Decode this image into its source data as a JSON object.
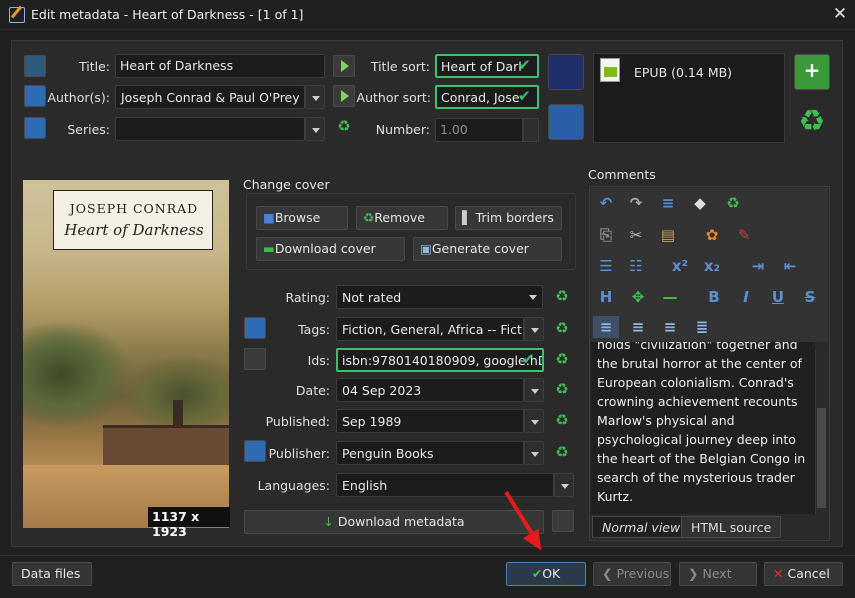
{
  "window": {
    "title": "Edit metadata - Heart of Darkness -  [1 of 1]",
    "close_glyph": "✕"
  },
  "fields": {
    "title": {
      "label": "Title:",
      "value": "Heart of Darkness"
    },
    "title_sort": {
      "label": "Title sort:",
      "value": "Heart of Darl"
    },
    "authors": {
      "label": "Author(s):",
      "value": "Joseph Conrad & Paul O'Prey"
    },
    "author_sort": {
      "label": "Author sort:",
      "value": "Conrad, Jose"
    },
    "series": {
      "label": "Series:",
      "value": ""
    },
    "number": {
      "label": "Number:",
      "value": "1.00"
    },
    "rating": {
      "label": "Rating:",
      "value": "Not rated"
    },
    "tags": {
      "label": "Tags:",
      "value": "Fiction, General, Africa -- Fiction,"
    },
    "ids": {
      "label": "Ids:",
      "value": "isbn:9780140180909, google:hD"
    },
    "date": {
      "label": "Date:",
      "value": "04 Sep 2023"
    },
    "published": {
      "label": "Published:",
      "value": "Sep 1989"
    },
    "publisher": {
      "label": "Publisher:",
      "value": "Penguin Books"
    },
    "languages": {
      "label": "Languages:",
      "value": "English"
    }
  },
  "format": {
    "label": "EPUB (0.14 MB)"
  },
  "cover": {
    "author_text": "JOSEPH CONRAD",
    "title_text": "Heart of Darkness",
    "dimensions": "1137 x 1923"
  },
  "change_cover": {
    "label": "Change cover",
    "browse": "Browse",
    "remove": "Remove",
    "trim": "Trim borders",
    "download": "Download cover",
    "generate": "Generate cover"
  },
  "download_metadata": "Download metadata",
  "comments": {
    "label": "Comments",
    "text_lines": [
      "holds \"civilization\" together and",
      "the brutal horror at the center of",
      "European colonialism. Conrad's",
      "crowning achievement recounts",
      "Marlow's physical and",
      "psychological journey deep into",
      "the heart of the Belgian Congo in",
      "search of the mysterious trader",
      "Kurtz."
    ],
    "tabs": [
      "Normal view",
      "HTML source"
    ]
  },
  "toolbar_icons": {
    "row1": [
      "undo-icon",
      "redo-icon",
      "select-all-icon",
      "clear-icon",
      "recycle-icon"
    ],
    "row2": [
      "copy-icon",
      "cut-icon",
      "paste-icon",
      "background-color-icon",
      "foreground-color-icon"
    ],
    "row3": [
      "ordered-list-icon",
      "unordered-list-icon",
      "superscript-icon",
      "subscript-icon",
      "indent-icon",
      "outdent-icon"
    ],
    "row4": [
      "heading-icon",
      "insert-link-icon",
      "horizontal-rule-icon",
      "bold-icon",
      "italic-icon",
      "underline-icon",
      "strikethrough-icon"
    ],
    "row5": [
      "align-left-icon",
      "align-center-icon",
      "align-right-icon",
      "align-justify-icon"
    ]
  },
  "toolbar_glyphs": {
    "undo": "↶",
    "redo": "↷",
    "copy": "⎘",
    "cut": "✂",
    "paste": "📋",
    "sup": "x²",
    "sub": "x₂",
    "heading": "H",
    "link": "✥",
    "bold": "B",
    "italic": "I",
    "underline": "U",
    "strike": "S"
  },
  "bottom": {
    "data_files": "Data files",
    "ok": "OK",
    "previous": "Previous",
    "next": "Next",
    "cancel": "Cancel"
  },
  "glyphs": {
    "check": "✔",
    "recycle": "♻",
    "plus": "+"
  },
  "colors": {
    "accent_green": "#3ec06b",
    "annotation_red": "#e81b1b"
  }
}
